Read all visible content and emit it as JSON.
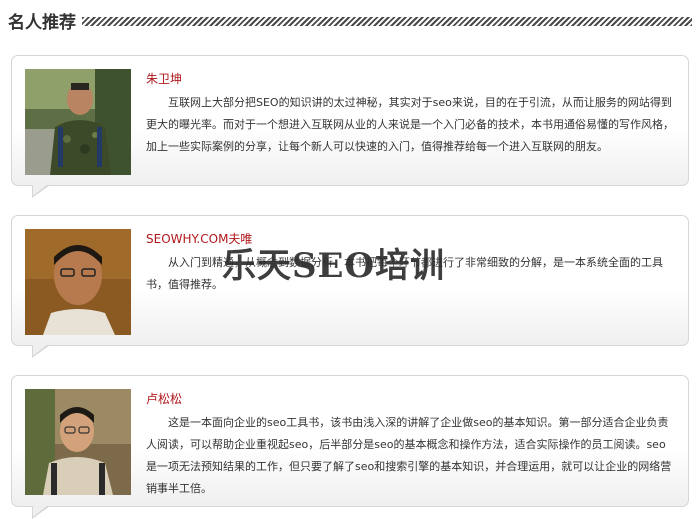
{
  "section": {
    "title": "名人推荐"
  },
  "recommendations": [
    {
      "name": "朱卫坤",
      "text": "互联网上大部分把SEO的知识讲的太过神秘，其实对于seo来说，目的在于引流，从而让服务的网站得到更大的曝光率。而对于一个想进入互联网从业的人来说是一个入门必备的技术，本书用通俗易懂的写作风格，加上一些实际案例的分享，让每个新人可以快速的入门，值得推荐给每一个进入互联网的朋友。"
    },
    {
      "name": "SEOWHY.COM夫唯",
      "text": "从入门到精通，从概念到数据分析，本书把每个环节都进行了非常细致的分解，是一本系统全面的工具书，值得推荐。"
    },
    {
      "name": "卢松松",
      "text": "这是一本面向企业的seo工具书，该书由浅入深的讲解了企业做seo的基本知识。第一部分适合企业负责人阅读，可以帮助企业重视起seo，后半部分是seo的基本概念和操作方法，适合实际操作的员工阅读。seo是一项无法预知结果的工作，但只要了解了seo和搜索引擎的基本知识，并合理运用，就可以让企业的网络营销事半工倍。"
    }
  ],
  "watermark": "乐天SEO培训",
  "colors": {
    "name_color": "#b0181c",
    "border": "#d6d6d6",
    "text": "#333333"
  }
}
